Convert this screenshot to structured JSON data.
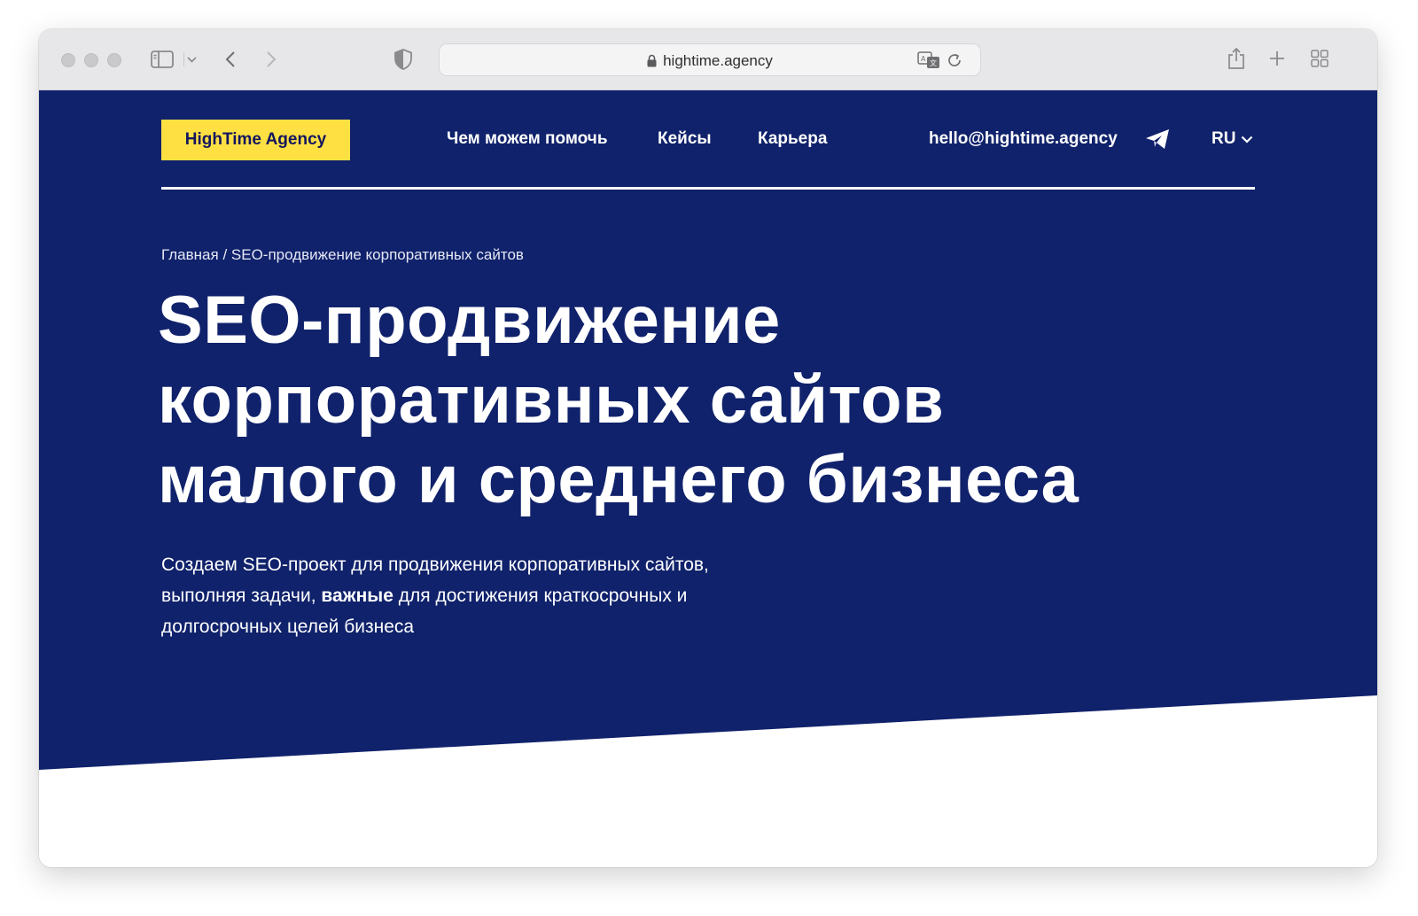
{
  "browser": {
    "url": "hightime.agency",
    "icons": [
      "sidebar-icon",
      "chevron-down-icon",
      "back-icon",
      "forward-icon",
      "shield-icon",
      "lock-icon",
      "translate-icon",
      "reload-icon",
      "share-icon",
      "new-tab-icon",
      "tab-overview-icon"
    ]
  },
  "header": {
    "logo": "HighTime Agency",
    "nav": [
      {
        "label": "Чем можем помочь"
      },
      {
        "label": "Кейсы"
      },
      {
        "label": "Карьера"
      }
    ],
    "email": "hello@hightime.agency",
    "lang": "RU"
  },
  "breadcrumb": {
    "home": "Главная",
    "separator": " / ",
    "current": "SEO-продвижение корпоративных сайтов"
  },
  "hero": {
    "title_lines": [
      "SEO-продвижение",
      "корпоративных сайтов",
      "малого и среднего бизнеса"
    ],
    "lead_part1": "Создаем SEO-проект для продвижения корпоративных сайтов, выполняя задачи, ",
    "lead_bold": "важные",
    "lead_part2": " для достижения краткосрочных и долгосрочных целей бизнеса"
  },
  "colors": {
    "hero_bg": "#10226b",
    "accent": "#ffe043",
    "text_on_dark": "#ffffff"
  }
}
